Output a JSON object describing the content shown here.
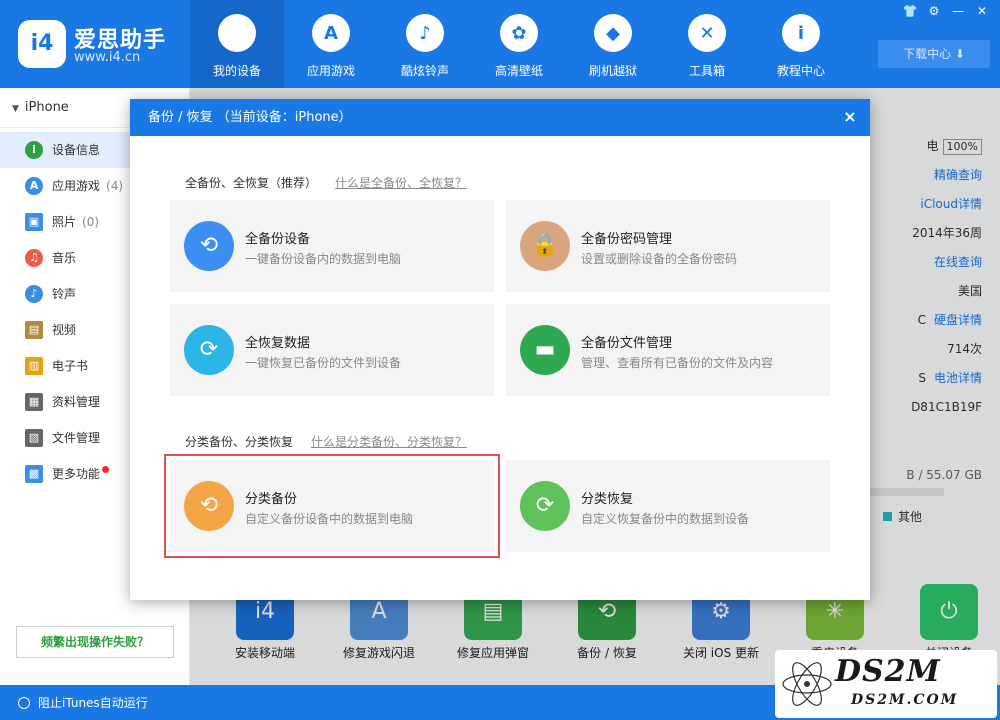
{
  "app": {
    "name": "爱思助手",
    "url": "www.i4.cn",
    "logo_text": "i4"
  },
  "nav": {
    "items": [
      {
        "label": "我的设备",
        "icon": "apple-icon",
        "glyph": ""
      },
      {
        "label": "应用游戏",
        "icon": "appstore-icon",
        "glyph": "A"
      },
      {
        "label": "酷炫铃声",
        "icon": "bell-icon",
        "glyph": "♪"
      },
      {
        "label": "高清壁纸",
        "icon": "flower-icon",
        "glyph": "✿"
      },
      {
        "label": "刷机越狱",
        "icon": "dropbox-icon",
        "glyph": "◆"
      },
      {
        "label": "工具箱",
        "icon": "tools-icon",
        "glyph": "✕"
      },
      {
        "label": "教程中心",
        "icon": "info-icon",
        "glyph": "i"
      }
    ],
    "download_label": "下载中心 ⬇"
  },
  "window_controls": [
    "👕",
    "⚙",
    "—",
    "✕"
  ],
  "sidebar": {
    "device": "iPhone",
    "items": [
      {
        "label": "设备信息",
        "count": "",
        "color": "#2ea043",
        "glyph": "i"
      },
      {
        "label": "应用游戏",
        "count": "(4)",
        "color": "#3a8ee6",
        "glyph": "A"
      },
      {
        "label": "照片",
        "count": "(0)",
        "color": "#3a8ee6",
        "glyph": "▣"
      },
      {
        "label": "音乐",
        "count": "",
        "color": "#f05a4a",
        "glyph": "♫"
      },
      {
        "label": "铃声",
        "count": "",
        "color": "#3a8ee6",
        "glyph": "♪"
      },
      {
        "label": "视频",
        "count": "",
        "color": "#b08b3d",
        "glyph": "▤"
      },
      {
        "label": "电子书",
        "count": "",
        "color": "#e8a019",
        "glyph": "▥"
      },
      {
        "label": "资料管理",
        "count": "",
        "color": "#666666",
        "glyph": "▦"
      },
      {
        "label": "文件管理",
        "count": "",
        "color": "#666666",
        "glyph": "▧"
      },
      {
        "label": "更多功能",
        "count": "",
        "color": "#3a8ee6",
        "glyph": "▩"
      }
    ],
    "help_label": "频繁出现操作失败？"
  },
  "main_bg": {
    "info_rows": [
      {
        "text": "电",
        "battery": "100%",
        "link": ""
      },
      {
        "text": "",
        "battery": "",
        "link": "精确查询"
      },
      {
        "text": "",
        "battery": "",
        "link": "iCloud详情"
      },
      {
        "text": "2014年36周",
        "battery": "",
        "link": ""
      },
      {
        "text": "",
        "battery": "",
        "link": "在线查询"
      },
      {
        "text": "美国",
        "battery": "",
        "link": ""
      },
      {
        "text": "C",
        "battery": "",
        "link": "硬盘详情"
      },
      {
        "text": "714次",
        "battery": "",
        "link": ""
      },
      {
        "text": "S",
        "battery": "",
        "link": "电池详情"
      },
      {
        "text": "D81C1B19F",
        "battery": "",
        "link": ""
      }
    ],
    "storage": "B / 55.07 GB",
    "legend_other": "其他",
    "tools": [
      {
        "label": "安装移动端",
        "color": "#1a6fd6",
        "glyph": "i4"
      },
      {
        "label": "修复游戏闪退",
        "color": "#4f8fd9",
        "glyph": "A"
      },
      {
        "label": "修复应用弹窗",
        "color": "#36a852",
        "glyph": "▤"
      },
      {
        "label": "备份 / 恢复",
        "color": "#2f9a44",
        "glyph": "⟲"
      },
      {
        "label": "关闭 iOS 更新",
        "color": "#3d7fd8",
        "glyph": "⚙"
      },
      {
        "label": "重启设备",
        "color": "#7cba3a",
        "glyph": "✳"
      },
      {
        "label": "关闭设备",
        "color": "#2ec36a",
        "glyph": "⏻"
      }
    ]
  },
  "status": {
    "itunes_label": "阻止iTunes自动运行"
  },
  "modal": {
    "title": "备份 / 恢复   （当前设备：iPhone）",
    "close": "×",
    "section1": {
      "title": "全备份、全恢复（推荐）",
      "link": "什么是全备份、全恢复？"
    },
    "section2": {
      "title": "分类备份、分类恢复",
      "link": "什么是分类备份、分类恢复？"
    },
    "cards": [
      {
        "title": "全备份设备",
        "desc": "一键备份设备内的数据到电脑",
        "color": "#3c8ff0",
        "glyph": "⟲"
      },
      {
        "title": "全备份密码管理",
        "desc": "设置或删除设备的全备份密码",
        "color": "#d9a57e",
        "glyph": "🔒"
      },
      {
        "title": "全恢复数据",
        "desc": "一键恢复已备份的文件到设备",
        "color": "#2bb6e6",
        "glyph": "⟳"
      },
      {
        "title": "全备份文件管理",
        "desc": "管理、查看所有已备份的文件及内容",
        "color": "#2ea853",
        "glyph": "▬"
      },
      {
        "title": "分类备份",
        "desc": "自定义备份设备中的数据到电脑",
        "color": "#f4a647",
        "glyph": "⟲"
      },
      {
        "title": "分类恢复",
        "desc": "自定义恢复备份中的数据到设备",
        "color": "#5fc25a",
        "glyph": "⟳"
      }
    ]
  },
  "watermark": {
    "main": "DS2M",
    "sub": "DS2M.COM"
  }
}
